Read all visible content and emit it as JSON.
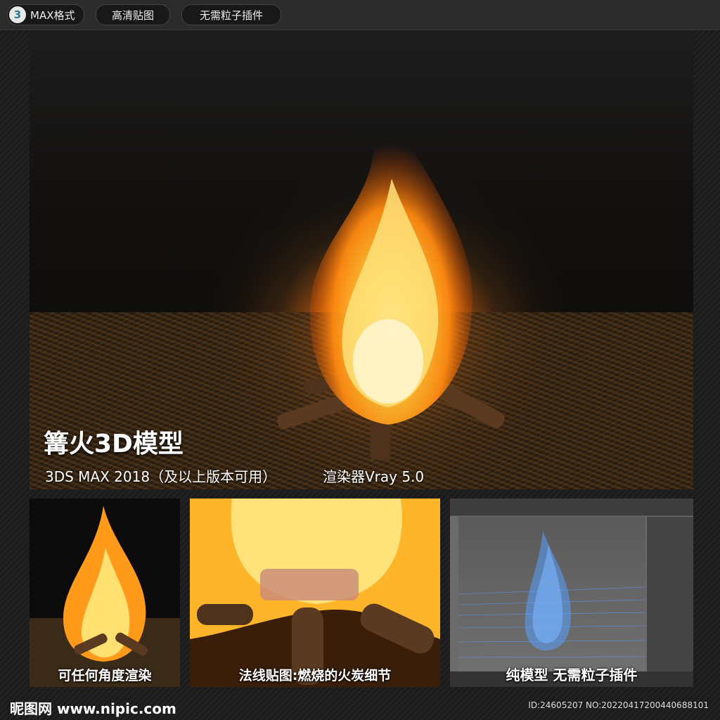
{
  "top_tags": {
    "format_badge": "3",
    "format": "MAX格式",
    "hd_texture": "高清贴图",
    "no_plugin": "无需粒子插件"
  },
  "hero": {
    "title": "篝火3D模型",
    "subtitle": "3DS MAX 2018（及以上版本可用）",
    "renderer": "渲染器Vray 5.0"
  },
  "thumbnails": [
    {
      "label": "可任何角度渲染"
    },
    {
      "label": "法线贴图:燃烧的火炭细节"
    },
    {
      "label": "纯模型 无需粒子插件"
    }
  ],
  "footer": {
    "logo": "昵图网 www.nipic.com",
    "id": "ID:24605207 NO:20220417200440688101"
  },
  "colors": {
    "fire_core": "#fff3a0",
    "fire_mid": "#ffb020",
    "fire_outer": "#e05a08",
    "wireframe": "#5aa0ff"
  }
}
